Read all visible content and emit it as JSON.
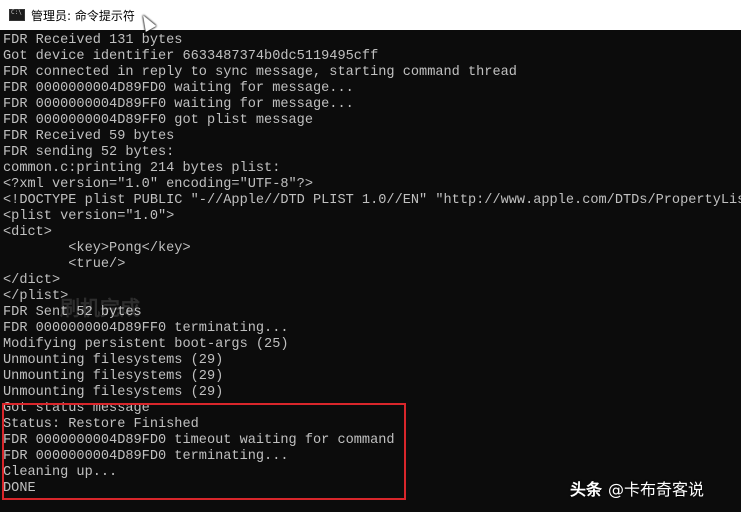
{
  "window": {
    "title": "管理员: 命令提示符",
    "title_icon": "cmd-icon",
    "background": "#0c0c0c",
    "text_color": "#c0c0c0",
    "highlight_color": "#d9262b"
  },
  "console": {
    "lines": [
      "FDR Received 131 bytes",
      "Got device identifier 6633487374b0dc5119495cff",
      "FDR connected in reply to sync message, starting command thread",
      "FDR 0000000004D89FD0 waiting for message...",
      "FDR 0000000004D89FF0 waiting for message...",
      "FDR 0000000004D89FF0 got plist message",
      "FDR Received 59 bytes",
      "FDR sending 52 bytes:",
      "common.c:printing 214 bytes plist:",
      "<?xml version=\"1.0\" encoding=\"UTF-8\"?>",
      "<!DOCTYPE plist PUBLIC \"-//Apple//DTD PLIST 1.0//EN\" \"http://www.apple.com/DTDs/PropertyList",
      "<plist version=\"1.0\">",
      "<dict>",
      "        <key>Pong</key>",
      "        <true/>",
      "</dict>",
      "</plist>",
      "FDR Sent 52 bytes",
      "FDR 0000000004D89FF0 terminating...",
      "Modifying persistent boot-args (25)",
      "Unmounting filesystems (29)",
      "Unmounting filesystems (29)",
      "Unmounting filesystems (29)",
      "Got status message",
      "Status: Restore Finished",
      "FDR 0000000004D89FD0 timeout waiting for command",
      "FDR 0000000004D89FD0 terminating...",
      "Cleaning up...",
      "DONE"
    ]
  },
  "overlay": {
    "ghost_text": "刷机完成"
  },
  "watermark": {
    "brand": "头条",
    "handle": "@卡布奇客说"
  }
}
